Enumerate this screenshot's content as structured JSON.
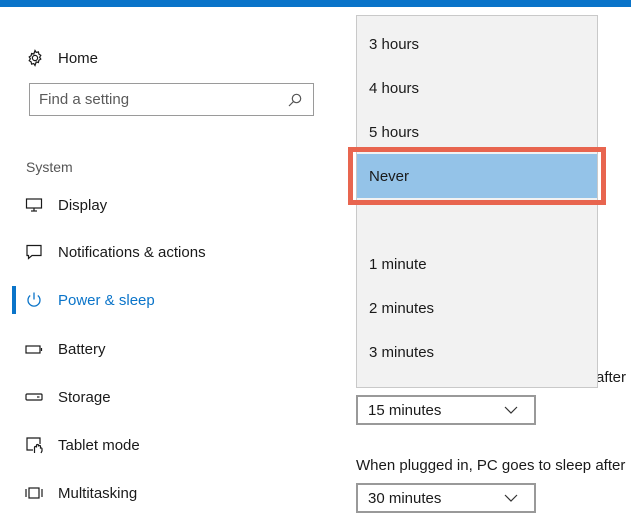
{
  "sidebar": {
    "home_label": "Home",
    "search_placeholder": "Find a setting",
    "section_label": "System",
    "items": [
      {
        "label": "Display"
      },
      {
        "label": "Notifications & actions"
      },
      {
        "label": "Power & sleep"
      },
      {
        "label": "Battery"
      },
      {
        "label": "Storage"
      },
      {
        "label": "Tablet mode"
      },
      {
        "label": "Multitasking"
      }
    ]
  },
  "main": {
    "partial_text": "after",
    "battery_dropdown_value": "15 minutes",
    "plugged_sleep_label": "When plugged in, PC goes to sleep after",
    "plugged_dropdown_value": "30 minutes"
  },
  "popup": {
    "options": [
      "3 hours",
      "4 hours",
      "5 hours",
      "Never",
      "",
      "1 minute",
      "2 minutes",
      "3 minutes"
    ],
    "selected": "Never"
  },
  "colors": {
    "accent": "#0a74c9",
    "selected_bg": "#94c3e8",
    "highlight_border": "#e8654f"
  }
}
